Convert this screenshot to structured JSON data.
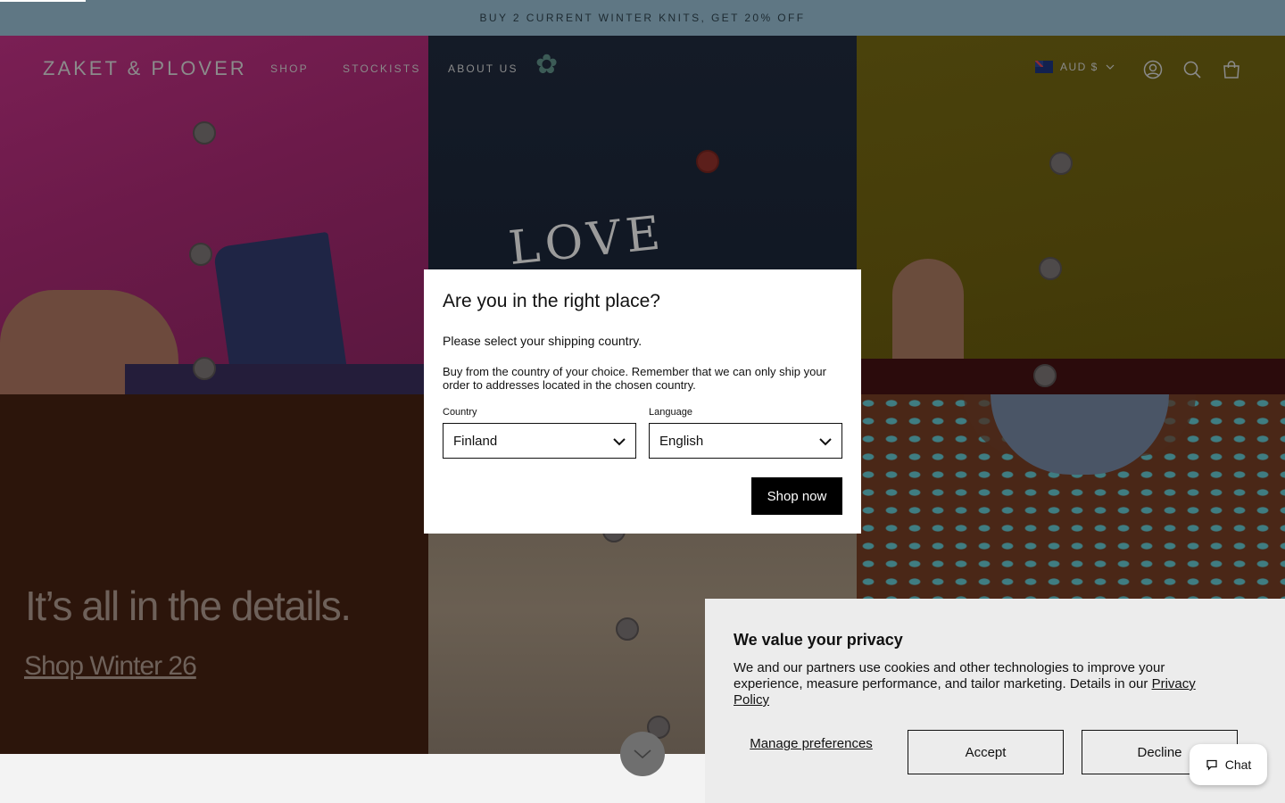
{
  "announcement": {
    "text": "BUY 2 CURRENT WINTER KNITS, GET 20% OFF"
  },
  "header": {
    "logo": "ZAKET & PLOVER",
    "nav": [
      {
        "label": "SHOP"
      },
      {
        "label": "STOCKISTS"
      },
      {
        "label": "ABOUT US"
      }
    ],
    "currency": "AUD $",
    "icons": [
      "flag-au-icon",
      "account-icon",
      "search-icon",
      "bag-icon"
    ]
  },
  "hero": {
    "tagline": "It’s all in the details.",
    "cta": "Shop Winter 26",
    "embroidery_text": "LOVE"
  },
  "modal": {
    "title": "Are you in the right place?",
    "subtitle": "Please select your shipping country.",
    "description": "Buy from the country of your choice. Remember that we can only ship your order to addresses located in the chosen country.",
    "country_label": "Country",
    "country_value": "Finland",
    "language_label": "Language",
    "language_value": "English",
    "submit": "Shop now"
  },
  "cookie": {
    "title": "We value your privacy",
    "text": "We and our partners use cookies and other technologies to improve your experience, measure performance, and tailor marketing. Details in our ",
    "link": "Privacy Policy",
    "manage": "Manage preferences",
    "accept": "Accept",
    "decline": "Decline"
  },
  "chat": {
    "label": "Chat"
  }
}
